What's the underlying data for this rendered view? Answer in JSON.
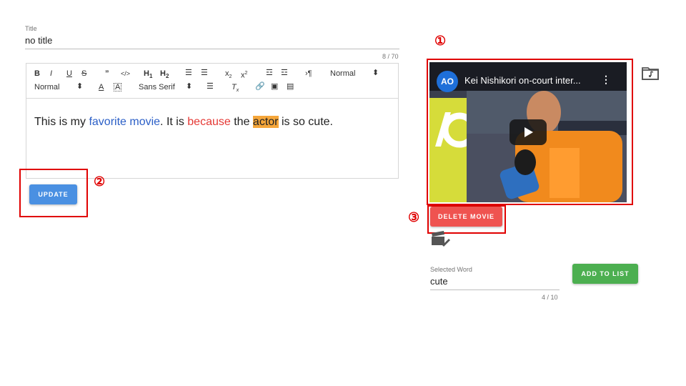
{
  "title_field": {
    "label": "Title",
    "value": "no title",
    "counter": "8 / 70"
  },
  "toolbar": {
    "row1": [
      "B",
      "I",
      "U",
      "S",
      "99",
      "</>",
      "H1",
      "H2",
      "ol",
      "ul",
      "x2",
      "x2",
      "indent-",
      "indent+",
      "¶",
      "Normal",
      "⬍"
    ],
    "size_label": "Normal",
    "font_label": "Sans Serif",
    "header_label": "Normal"
  },
  "editor": {
    "seg1": "This is my ",
    "seg2": "favorite movie",
    "seg3": ". It is ",
    "seg4": "because",
    "seg5": " the ",
    "seg6": "actor",
    "seg7": " is so cute."
  },
  "update_button": {
    "label": "UPDATE"
  },
  "video": {
    "title": "Kei Nishikori on-court inter...",
    "channel_logo": "AO"
  },
  "delete_button": {
    "label": "DELETE MOVIE"
  },
  "selected_word": {
    "label": "Selected Word",
    "value": "cute",
    "counter": "4 / 10"
  },
  "add_button": {
    "label": "ADD TO LIST"
  },
  "markers": {
    "m1": "①",
    "m2": "②",
    "m3": "③"
  },
  "colors": {
    "update": "#4a90e2",
    "delete": "#ef5350",
    "add": "#4caf50",
    "highlight": "#e00000"
  }
}
